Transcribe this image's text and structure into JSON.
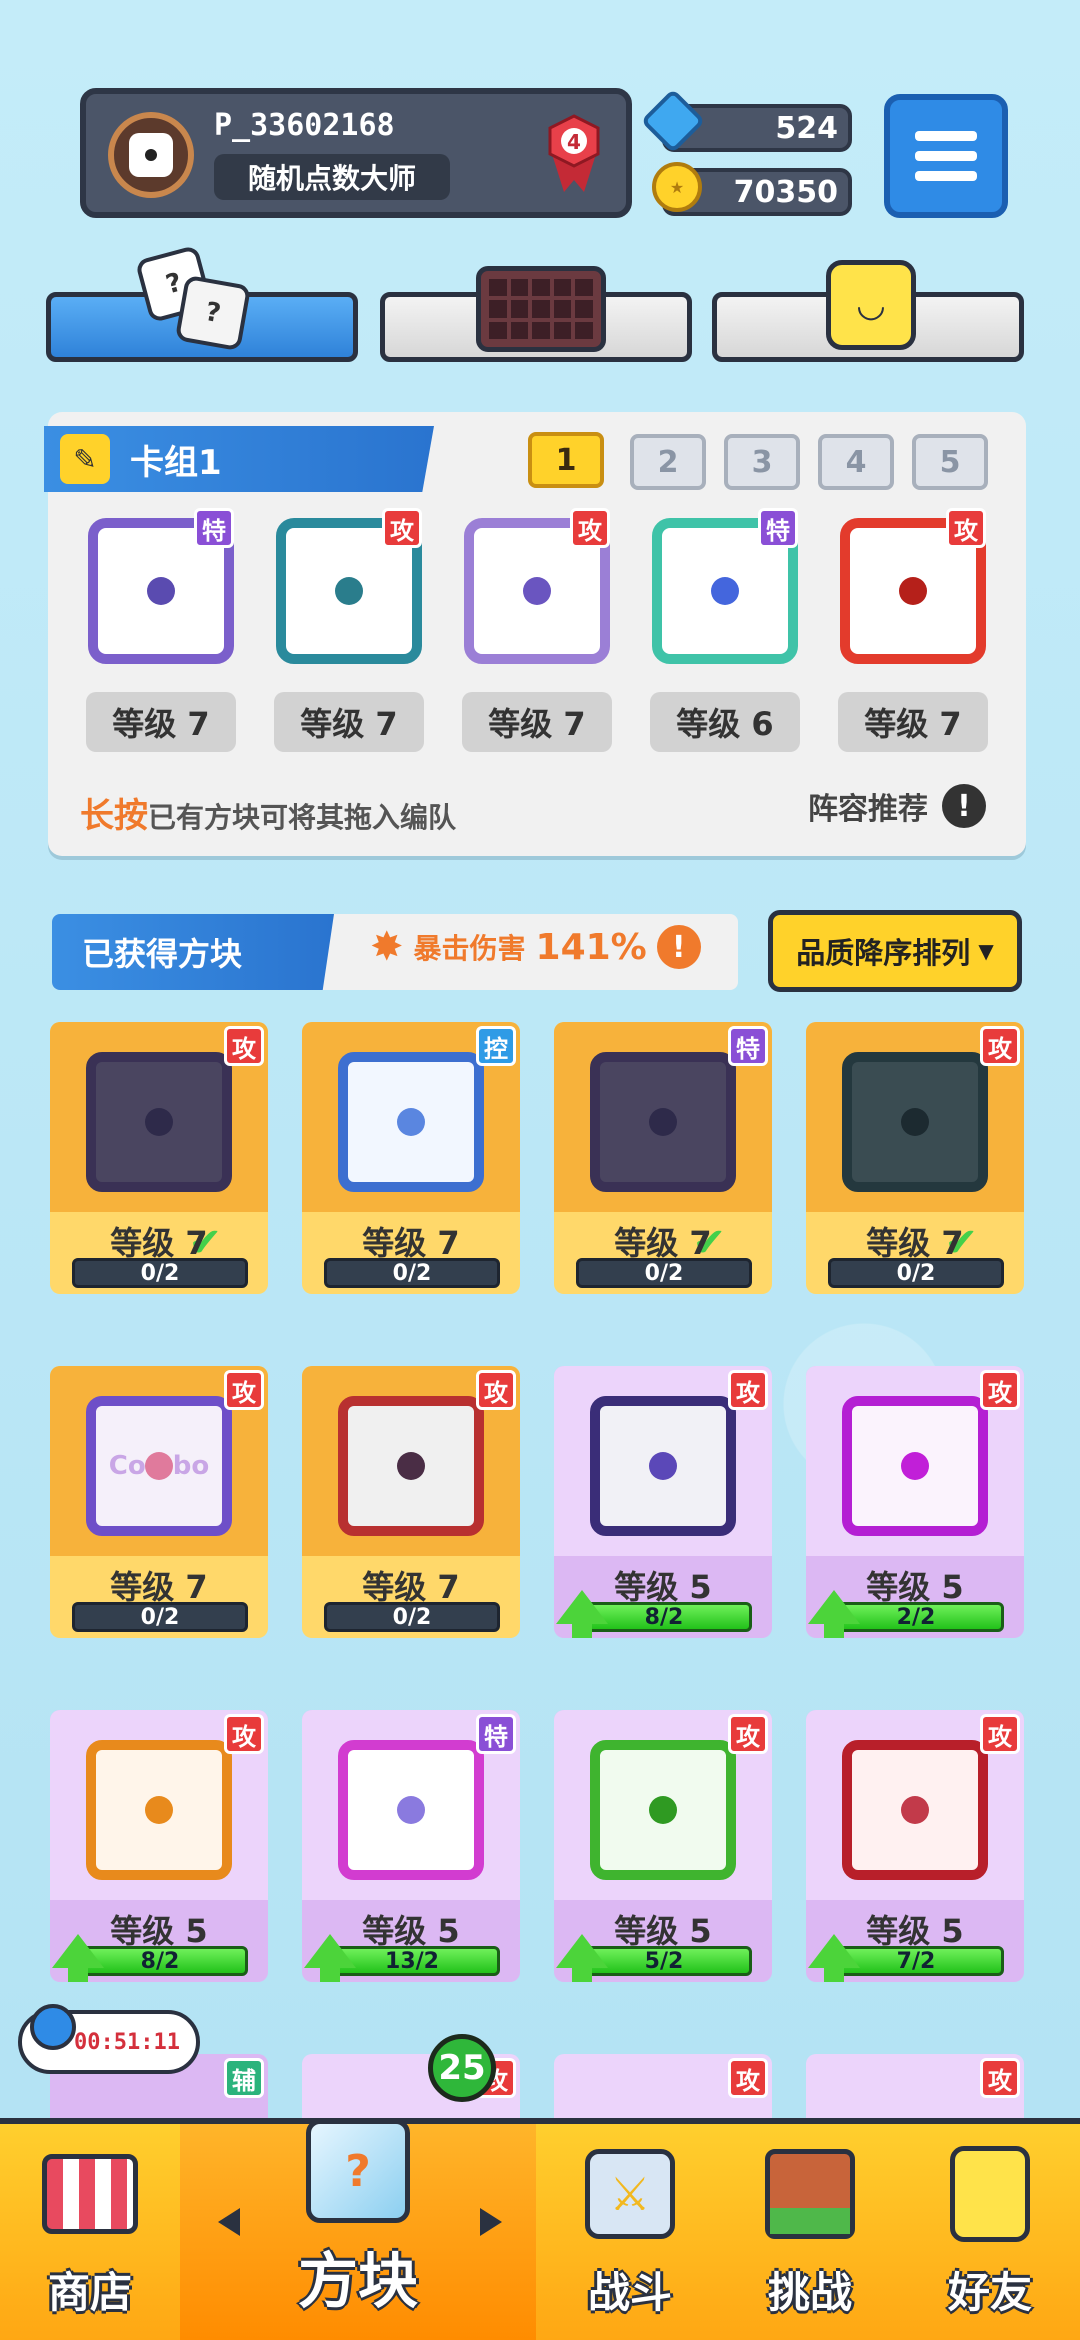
{
  "profile": {
    "name": "P_33602168",
    "title": "随机点数大师",
    "rank": "4"
  },
  "currency": {
    "gems": "524",
    "coins": "70350"
  },
  "deck": {
    "title": "卡组1",
    "slots": [
      "1",
      "2",
      "3",
      "4",
      "5"
    ],
    "active_slot": "1",
    "cards": [
      {
        "tag": "特",
        "level": "等级 7",
        "color": "#7b5fcb",
        "dot": "#5a4bb0"
      },
      {
        "tag": "攻",
        "level": "等级 7",
        "color": "#2a8a9c",
        "dot": "#2a7d8c"
      },
      {
        "tag": "攻",
        "level": "等级 7",
        "color": "#9b7fd6",
        "dot": "#6a55c0"
      },
      {
        "tag": "特",
        "level": "等级 6",
        "color": "#3fc3a8",
        "dot": "#4466dd"
      },
      {
        "tag": "攻",
        "level": "等级 7",
        "color": "#e33b2c",
        "dot": "#b5201a"
      }
    ],
    "hint_key": "长按",
    "hint_rest": "已有方块可将其拖入编队",
    "recommend": "阵容推荐",
    "excl": "!"
  },
  "obtained": {
    "title": "已获得方块",
    "crit_label": "暴击伤害",
    "crit_value": "141%",
    "excl": "!",
    "sort_label": "品质降序排列",
    "sort_arrow": "▼"
  },
  "cards": [
    {
      "tag": "攻",
      "tagtype": "atk",
      "level": "等级 7",
      "progress": "0/2",
      "style": "gold",
      "tile": "#4a4560",
      "border": "#3a3155",
      "dot": "#2e2a4a",
      "check": "✔",
      "upgrade": false
    },
    {
      "tag": "控",
      "tagtype": "ctl",
      "level": "等级 7",
      "progress": "0/2",
      "style": "gold",
      "tile": "#f2f7ff",
      "border": "#3d6fd0",
      "dot": "#5a86e0",
      "check": "",
      "upgrade": false
    },
    {
      "tag": "特",
      "tagtype": "spc",
      "level": "等级 7",
      "progress": "0/2",
      "style": "gold",
      "tile": "#4a4560",
      "border": "#3a3155",
      "dot": "#2e2a4a",
      "check": "✔",
      "upgrade": false
    },
    {
      "tag": "攻",
      "tagtype": "atk",
      "level": "等级 7",
      "progress": "0/2",
      "style": "gold",
      "tile": "#3a4c52",
      "border": "#24383e",
      "dot": "#1c2a30",
      "check": "✔",
      "upgrade": false
    },
    {
      "tag": "攻",
      "tagtype": "atk",
      "level": "等级 7",
      "progress": "0/2",
      "style": "gold",
      "tile": "#f5f0fa",
      "border": "#6e4fc8",
      "dot": "#e07a9c",
      "check": "",
      "upgrade": false,
      "word": "Combo"
    },
    {
      "tag": "攻",
      "tagtype": "atk",
      "level": "等级 7",
      "progress": "0/2",
      "style": "gold",
      "tile": "#f0f0f0",
      "border": "#b83030",
      "dot": "#4a2d45",
      "check": "",
      "upgrade": false
    },
    {
      "tag": "攻",
      "tagtype": "atk",
      "level": "等级 5",
      "progress": "8/2",
      "style": "purple",
      "tile": "#f1f1f6",
      "border": "#3a2d78",
      "dot": "#5b48b8",
      "check": "",
      "upgrade": true
    },
    {
      "tag": "攻",
      "tagtype": "atk",
      "level": "等级 5",
      "progress": "2/2",
      "style": "purple",
      "tile": "#fbf3fd",
      "border": "#b41fd3",
      "dot": "#c11fd8",
      "check": "",
      "upgrade": true
    },
    {
      "tag": "攻",
      "tagtype": "atk",
      "level": "等级 5",
      "progress": "8/2",
      "style": "purple",
      "tile": "#fff5ea",
      "border": "#e88a1c",
      "dot": "#e88a1c",
      "check": "",
      "upgrade": true
    },
    {
      "tag": "特",
      "tagtype": "spc",
      "level": "等级 5",
      "progress": "13/2",
      "style": "purple",
      "tile": "#ffffff",
      "border": "#d23cd0",
      "dot": "#8a7adf",
      "check": "",
      "upgrade": true
    },
    {
      "tag": "攻",
      "tagtype": "atk",
      "level": "等级 5",
      "progress": "5/2",
      "style": "purple",
      "tile": "#f1fbef",
      "border": "#3fb42f",
      "dot": "#2f9a22",
      "check": "",
      "upgrade": true
    },
    {
      "tag": "攻",
      "tagtype": "atk",
      "level": "等级 5",
      "progress": "7/2",
      "style": "purple",
      "tile": "#fff1f1",
      "border": "#b81f2a",
      "dot": "#c23a4a",
      "check": "",
      "upgrade": true
    }
  ],
  "partial_tags": [
    "辅",
    "攻",
    "攻",
    "攻"
  ],
  "timer": "00:51:11",
  "badge": "25",
  "nav": {
    "shop": "商店",
    "blocks": "方块",
    "battle": "战斗",
    "challenge": "挑战",
    "friends": "好友"
  }
}
